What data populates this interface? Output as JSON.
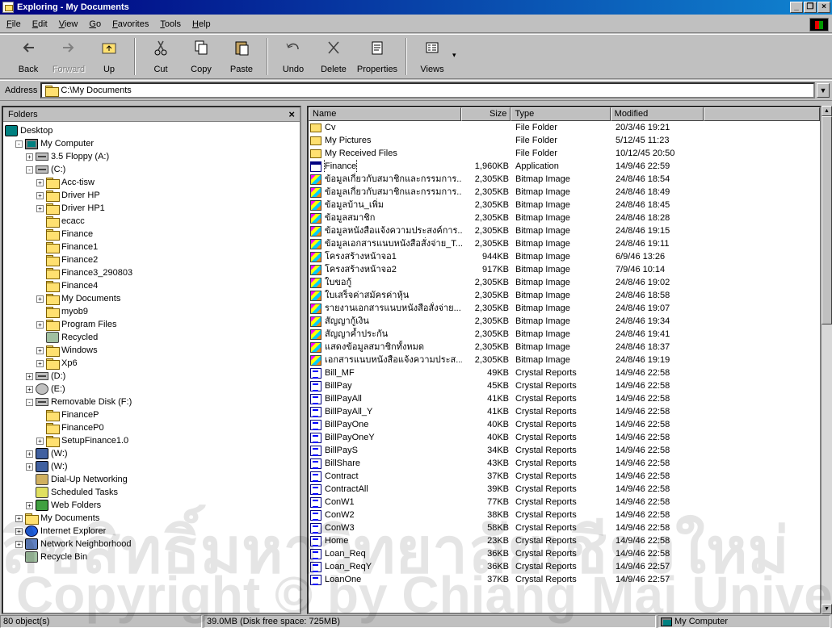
{
  "window": {
    "title": "Exploring - My Documents"
  },
  "menu": [
    "File",
    "Edit",
    "View",
    "Go",
    "Favorites",
    "Tools",
    "Help"
  ],
  "toolbar": {
    "back": "Back",
    "forward": "Forward",
    "up": "Up",
    "cut": "Cut",
    "copy": "Copy",
    "paste": "Paste",
    "undo": "Undo",
    "delete": "Delete",
    "properties": "Properties",
    "views": "Views"
  },
  "address": {
    "label": "Address",
    "value": "C:\\My Documents"
  },
  "folders": {
    "title": "Folders",
    "close": "×",
    "tree": [
      {
        "label": "Desktop",
        "indent": 0,
        "icon": "desktop",
        "exp": ""
      },
      {
        "label": "My Computer",
        "indent": 1,
        "icon": "computer",
        "exp": "-"
      },
      {
        "label": "3.5 Floppy (A:)",
        "indent": 2,
        "icon": "drive",
        "exp": "+"
      },
      {
        "label": "(C:)",
        "indent": 2,
        "icon": "drive",
        "exp": "-"
      },
      {
        "label": "Acc-tisw",
        "indent": 3,
        "icon": "folder",
        "exp": "+"
      },
      {
        "label": "Driver HP",
        "indent": 3,
        "icon": "folder",
        "exp": "+"
      },
      {
        "label": "Driver HP1",
        "indent": 3,
        "icon": "folder",
        "exp": "+"
      },
      {
        "label": "ecacc",
        "indent": 3,
        "icon": "folder",
        "exp": ""
      },
      {
        "label": "Finance",
        "indent": 3,
        "icon": "folder",
        "exp": ""
      },
      {
        "label": "Finance1",
        "indent": 3,
        "icon": "folder",
        "exp": ""
      },
      {
        "label": "Finance2",
        "indent": 3,
        "icon": "folder",
        "exp": ""
      },
      {
        "label": "Finance3_290803",
        "indent": 3,
        "icon": "folder",
        "exp": ""
      },
      {
        "label": "Finance4",
        "indent": 3,
        "icon": "folder",
        "exp": ""
      },
      {
        "label": "My Documents",
        "indent": 3,
        "icon": "folder",
        "exp": "+"
      },
      {
        "label": "myob9",
        "indent": 3,
        "icon": "folder",
        "exp": ""
      },
      {
        "label": "Program Files",
        "indent": 3,
        "icon": "folder",
        "exp": "+"
      },
      {
        "label": "Recycled",
        "indent": 3,
        "icon": "recycle",
        "exp": ""
      },
      {
        "label": "Windows",
        "indent": 3,
        "icon": "folder",
        "exp": "+"
      },
      {
        "label": "Xp6",
        "indent": 3,
        "icon": "folder",
        "exp": "+"
      },
      {
        "label": "(D:)",
        "indent": 2,
        "icon": "drive",
        "exp": "+"
      },
      {
        "label": "(E:)",
        "indent": 2,
        "icon": "cd",
        "exp": "+"
      },
      {
        "label": "Removable Disk (F:)",
        "indent": 2,
        "icon": "drive",
        "exp": "-"
      },
      {
        "label": "FinanceP",
        "indent": 3,
        "icon": "folder",
        "exp": ""
      },
      {
        "label": "FinanceP0",
        "indent": 3,
        "icon": "folder",
        "exp": ""
      },
      {
        "label": "SetupFinance1.0",
        "indent": 3,
        "icon": "folder",
        "exp": "+"
      },
      {
        "label": "(W:)",
        "indent": 2,
        "icon": "net",
        "exp": "+"
      },
      {
        "label": "(W:)",
        "indent": 2,
        "icon": "net",
        "exp": "+"
      },
      {
        "label": "Dial-Up Networking",
        "indent": 2,
        "icon": "dialup",
        "exp": ""
      },
      {
        "label": "Scheduled Tasks",
        "indent": 2,
        "icon": "tasks",
        "exp": ""
      },
      {
        "label": "Web Folders",
        "indent": 2,
        "icon": "web",
        "exp": "+"
      },
      {
        "label": "My Documents",
        "indent": 1,
        "icon": "folder",
        "exp": "+"
      },
      {
        "label": "Internet Explorer",
        "indent": 1,
        "icon": "ie",
        "exp": "+"
      },
      {
        "label": "Network Neighborhood",
        "indent": 1,
        "icon": "network",
        "exp": "+"
      },
      {
        "label": "Recycle Bin",
        "indent": 1,
        "icon": "recycle",
        "exp": ""
      }
    ]
  },
  "list": {
    "columns": [
      "Name",
      "Size",
      "Type",
      "Modified"
    ],
    "rows": [
      {
        "name": "Cv",
        "size": "",
        "type": "File Folder",
        "modified": "20/3/46 19:21",
        "icon": "folder"
      },
      {
        "name": "My Pictures",
        "size": "",
        "type": "File Folder",
        "modified": "5/12/45 11:23",
        "icon": "folder"
      },
      {
        "name": "My Received Files",
        "size": "",
        "type": "File Folder",
        "modified": "10/12/45 20:50",
        "icon": "folder"
      },
      {
        "name": "Finance",
        "size": "1,960KB",
        "type": "Application",
        "modified": "14/9/46 22:59",
        "icon": "app"
      },
      {
        "name": "ข้อมูลเกี่ยวกับสมาชิกและกรรมการ...",
        "size": "2,305KB",
        "type": "Bitmap Image",
        "modified": "24/8/46 18:54",
        "icon": "bmp"
      },
      {
        "name": "ข้อมูลเกี่ยวกับสมาชิกและกรรมการ...",
        "size": "2,305KB",
        "type": "Bitmap Image",
        "modified": "24/8/46 18:49",
        "icon": "bmp"
      },
      {
        "name": "ข้อมูลบ้าน_เพิ่ม",
        "size": "2,305KB",
        "type": "Bitmap Image",
        "modified": "24/8/46 18:45",
        "icon": "bmp"
      },
      {
        "name": "ข้อมูลสมาชิก",
        "size": "2,305KB",
        "type": "Bitmap Image",
        "modified": "24/8/46 18:28",
        "icon": "bmp"
      },
      {
        "name": "ข้อมูลหนังสือแจ้งความประสงค์การ...",
        "size": "2,305KB",
        "type": "Bitmap Image",
        "modified": "24/8/46 19:15",
        "icon": "bmp"
      },
      {
        "name": "ข้อมูลเอกสารแนบหนังสือสั่งจ่าย_T...",
        "size": "2,305KB",
        "type": "Bitmap Image",
        "modified": "24/8/46 19:11",
        "icon": "bmp"
      },
      {
        "name": "โครงสร้างหน้าจอ1",
        "size": "944KB",
        "type": "Bitmap Image",
        "modified": "6/9/46 13:26",
        "icon": "bmp"
      },
      {
        "name": "โครงสร้างหน้าจอ2",
        "size": "917KB",
        "type": "Bitmap Image",
        "modified": "7/9/46 10:14",
        "icon": "bmp"
      },
      {
        "name": "ใบขอกู้",
        "size": "2,305KB",
        "type": "Bitmap Image",
        "modified": "24/8/46 19:02",
        "icon": "bmp"
      },
      {
        "name": "ใบเสร็จค่าสมัครค่าหุ้น",
        "size": "2,305KB",
        "type": "Bitmap Image",
        "modified": "24/8/46 18:58",
        "icon": "bmp"
      },
      {
        "name": "รายงานเอกสารแนบหนังสือสั่งจ่าย...",
        "size": "2,305KB",
        "type": "Bitmap Image",
        "modified": "24/8/46 19:07",
        "icon": "bmp"
      },
      {
        "name": "สัญญากู้เงิน",
        "size": "2,305KB",
        "type": "Bitmap Image",
        "modified": "24/8/46 19:34",
        "icon": "bmp"
      },
      {
        "name": "สัญญาค้ำประกัน",
        "size": "2,305KB",
        "type": "Bitmap Image",
        "modified": "24/8/46 19:41",
        "icon": "bmp"
      },
      {
        "name": "แสดงข้อมูลสมาชิกทั้งหมด",
        "size": "2,305KB",
        "type": "Bitmap Image",
        "modified": "24/8/46 18:37",
        "icon": "bmp"
      },
      {
        "name": "เอกสารแนบหนังสือแจ้งความประส...",
        "size": "2,305KB",
        "type": "Bitmap Image",
        "modified": "24/8/46 19:19",
        "icon": "bmp"
      },
      {
        "name": "Bill_MF",
        "size": "49KB",
        "type": "Crystal Reports",
        "modified": "14/9/46 22:58",
        "icon": "rpt"
      },
      {
        "name": "BillPay",
        "size": "45KB",
        "type": "Crystal Reports",
        "modified": "14/9/46 22:58",
        "icon": "rpt"
      },
      {
        "name": "BillPayAll",
        "size": "41KB",
        "type": "Crystal Reports",
        "modified": "14/9/46 22:58",
        "icon": "rpt"
      },
      {
        "name": "BillPayAll_Y",
        "size": "41KB",
        "type": "Crystal Reports",
        "modified": "14/9/46 22:58",
        "icon": "rpt"
      },
      {
        "name": "BillPayOne",
        "size": "40KB",
        "type": "Crystal Reports",
        "modified": "14/9/46 22:58",
        "icon": "rpt"
      },
      {
        "name": "BillPayOneY",
        "size": "40KB",
        "type": "Crystal Reports",
        "modified": "14/9/46 22:58",
        "icon": "rpt"
      },
      {
        "name": "BillPayS",
        "size": "34KB",
        "type": "Crystal Reports",
        "modified": "14/9/46 22:58",
        "icon": "rpt"
      },
      {
        "name": "BillShare",
        "size": "43KB",
        "type": "Crystal Reports",
        "modified": "14/9/46 22:58",
        "icon": "rpt"
      },
      {
        "name": "Contract",
        "size": "37KB",
        "type": "Crystal Reports",
        "modified": "14/9/46 22:58",
        "icon": "rpt"
      },
      {
        "name": "ContractAll",
        "size": "39KB",
        "type": "Crystal Reports",
        "modified": "14/9/46 22:58",
        "icon": "rpt"
      },
      {
        "name": "ConW1",
        "size": "77KB",
        "type": "Crystal Reports",
        "modified": "14/9/46 22:58",
        "icon": "rpt"
      },
      {
        "name": "ConW2",
        "size": "38KB",
        "type": "Crystal Reports",
        "modified": "14/9/46 22:58",
        "icon": "rpt"
      },
      {
        "name": "ConW3",
        "size": "58KB",
        "type": "Crystal Reports",
        "modified": "14/9/46 22:58",
        "icon": "rpt"
      },
      {
        "name": "Home",
        "size": "23KB",
        "type": "Crystal Reports",
        "modified": "14/9/46 22:58",
        "icon": "rpt"
      },
      {
        "name": "Loan_Req",
        "size": "36KB",
        "type": "Crystal Reports",
        "modified": "14/9/46 22:58",
        "icon": "rpt"
      },
      {
        "name": "Loan_ReqY",
        "size": "36KB",
        "type": "Crystal Reports",
        "modified": "14/9/46 22:57",
        "icon": "rpt"
      },
      {
        "name": "LoanOne",
        "size": "37KB",
        "type": "Crystal Reports",
        "modified": "14/9/46 22:57",
        "icon": "rpt"
      }
    ]
  },
  "status": {
    "objects": "80 object(s)",
    "disk": "39.0MB (Disk free space: 725MB)",
    "location": "My Computer"
  },
  "watermark": {
    "line1": "ลิขสิทธิ์มหาวิทยาลัยเชียงใหม่",
    "line2": "Copyright © by Chiang Mai University"
  }
}
